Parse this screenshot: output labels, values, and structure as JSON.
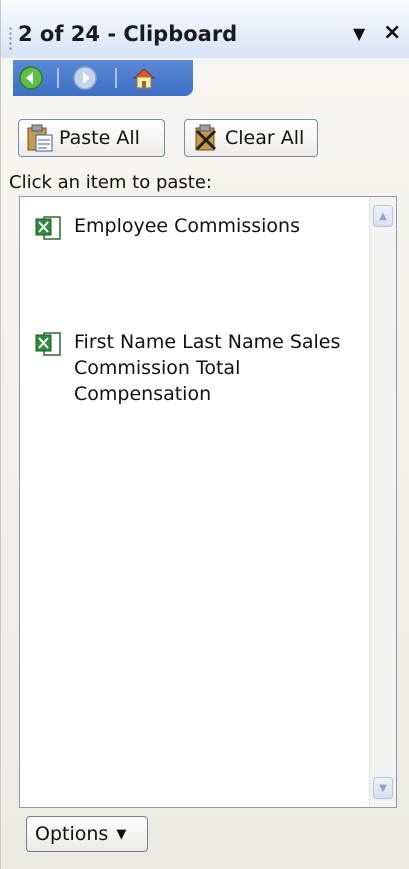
{
  "pane": {
    "title": "2 of 24 - Clipboard",
    "menu_glyph": "▼",
    "close_glyph": "×"
  },
  "nav": {
    "back_icon": "back-arrow-icon",
    "forward_icon": "forward-arrow-icon",
    "home_icon": "home-icon"
  },
  "buttons": {
    "paste_all": "Paste All",
    "clear_all": "Clear All"
  },
  "hint": "Click an item to paste:",
  "items": [
    {
      "icon": "excel-icon",
      "text": "Employee Commissions"
    },
    {
      "icon": "excel-icon",
      "text": "First Name Last Name Sales Commission Total Compensation"
    }
  ],
  "options": {
    "label": "Options",
    "caret": "▼"
  },
  "colors": {
    "nav_bar": "#3e6fc4",
    "title_bg": "#d8e3f7"
  }
}
